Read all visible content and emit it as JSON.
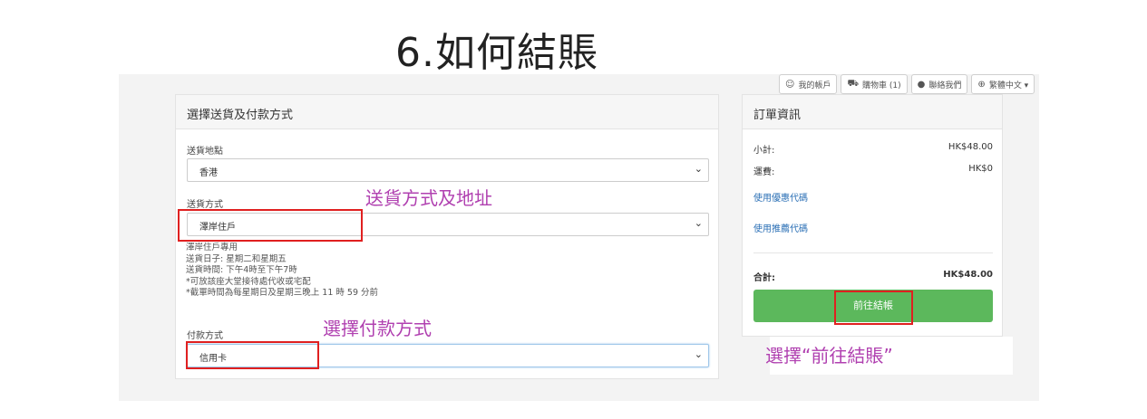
{
  "slide": {
    "title": "6.如何結賬"
  },
  "topnav": [
    {
      "icon": "user-icon",
      "glyph": "☺",
      "label": "我的帳戶"
    },
    {
      "icon": "cart-icon",
      "glyph": "⛟",
      "label": "購物車 (1)"
    },
    {
      "icon": "chat-icon",
      "glyph": "●",
      "label": "聯絡我們"
    },
    {
      "icon": "globe-icon",
      "glyph": "⊕",
      "label": "繁體中文 ▾"
    }
  ],
  "shipping_panel": {
    "title": "選擇送貨及付款方式",
    "location_label": "送貨地點",
    "location_value": "香港",
    "method_label": "送貨方式",
    "method_value": "澤岸住戶",
    "notes": [
      "澤岸住戶專用",
      "送貨日子: 星期二和星期五",
      "送貨時間: 下午4時至下午7時",
      "*可放該座大堂接待處代收或宅配",
      "*截單時間為每星期日及星期三晚上 11 時 59 分前"
    ],
    "payment_label": "付款方式",
    "payment_value": "信用卡"
  },
  "order_panel": {
    "title": "訂單資訊",
    "subtotal_label": "小計:",
    "subtotal_value": "HK$48.00",
    "shipping_label": "運費:",
    "shipping_value": "HK$0",
    "coupon_link": "使用優惠代碼",
    "referral_link": "使用推薦代碼",
    "total_label": "合計:",
    "total_value": "HK$48.00",
    "checkout_label": "前往結帳"
  },
  "annotations": {
    "shipping": "送貨方式及地址",
    "payment": "選擇付款方式",
    "checkout": "選擇“前往結賬”"
  },
  "colors": {
    "annotation": "#b040b0",
    "highlight_box": "#e02020",
    "checkout_button": "#5cb85c",
    "link": "#2a6fb5"
  }
}
